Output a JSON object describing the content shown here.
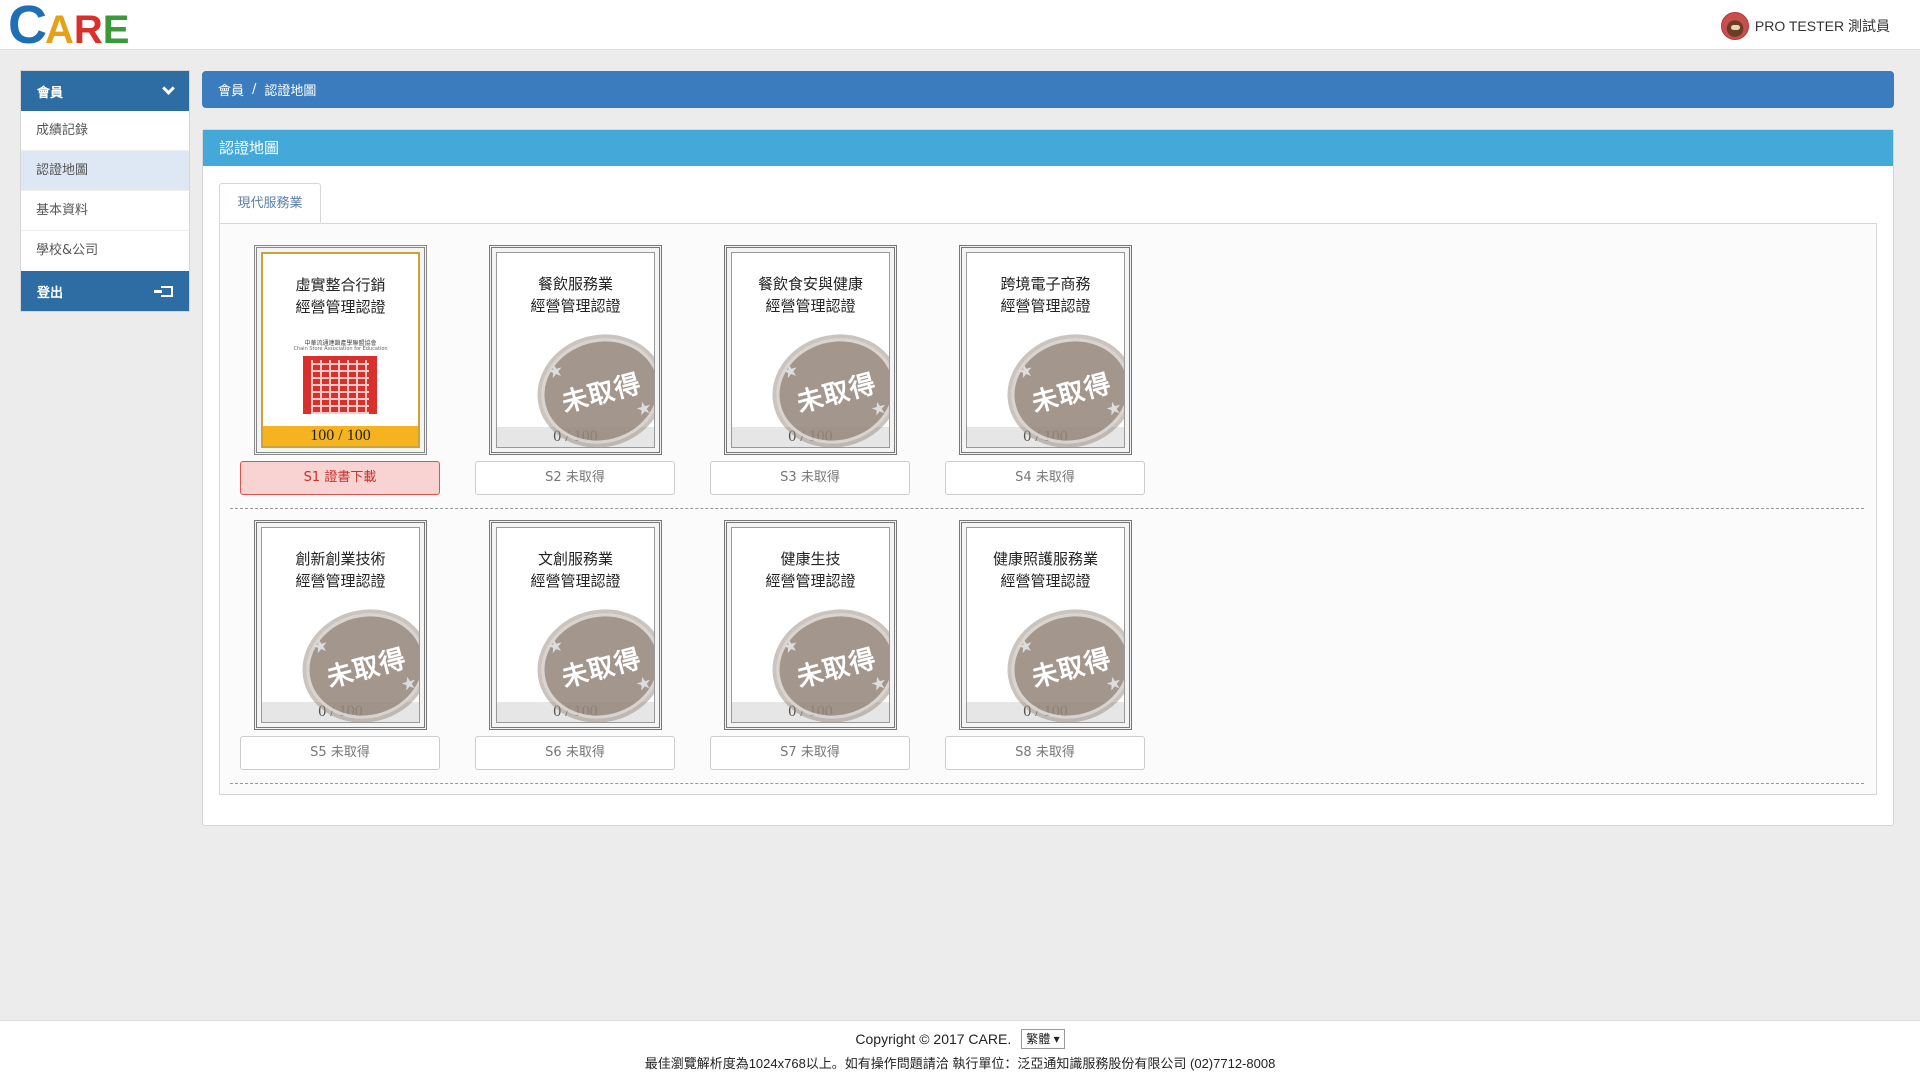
{
  "header": {
    "logo": {
      "c": "C",
      "a": "A",
      "r": "R",
      "e": "E"
    },
    "user_name": "PRO TESTER 測試員"
  },
  "sidebar": {
    "section_label": "會員",
    "items": [
      {
        "label": "成績記錄",
        "active": false
      },
      {
        "label": "認證地圖",
        "active": true
      },
      {
        "label": "基本資料",
        "active": false
      },
      {
        "label": "學校&公司",
        "active": false
      }
    ],
    "logout_label": "登出"
  },
  "breadcrumb": {
    "parent": "會員",
    "separator": "/",
    "current": "認證地圖"
  },
  "panel": {
    "title": "認證地圖",
    "tab_label": "現代服務業"
  },
  "certificates": [
    {
      "line1": "虛實整合行銷",
      "line2": "經營管理認證",
      "score": "100 / 100",
      "button": "S1 證書下載",
      "obtained": true,
      "org": "中華流通連鎖產學聯盟協會",
      "org_en": "Chain Store Association for Education"
    },
    {
      "line1": "餐飲服務業",
      "line2": "經營管理認證",
      "score": "0 / 100",
      "button": "S2 未取得",
      "obtained": false,
      "badge": "未取得"
    },
    {
      "line1": "餐飲食安與健康",
      "line2": "經營管理認證",
      "score": "0 / 100",
      "button": "S3 未取得",
      "obtained": false,
      "badge": "未取得"
    },
    {
      "line1": "跨境電子商務",
      "line2": "經營管理認證",
      "score": "0 / 100",
      "button": "S4 未取得",
      "obtained": false,
      "badge": "未取得"
    },
    {
      "line1": "創新創業技術",
      "line2": "經營管理認證",
      "score": "0 / 100",
      "button": "S5 未取得",
      "obtained": false,
      "badge": "未取得"
    },
    {
      "line1": "文創服務業",
      "line2": "經營管理認證",
      "score": "0 / 100",
      "button": "S6 未取得",
      "obtained": false,
      "badge": "未取得"
    },
    {
      "line1": "健康生技",
      "line2": "經營管理認證",
      "score": "0 / 100",
      "button": "S7 未取得",
      "obtained": false,
      "badge": "未取得"
    },
    {
      "line1": "健康照護服務業",
      "line2": "經營管理認證",
      "score": "0 / 100",
      "button": "S8 未取得",
      "obtained": false,
      "badge": "未取得"
    }
  ],
  "footer": {
    "copyright": "Copyright © 2017 CARE.",
    "language": "繁體 ▾",
    "notice": "最佳瀏覽解析度為1024x768以上。如有操作問題請洽 執行單位：泛亞通知識服務股份有限公司 (02)7712-8008"
  },
  "colors": {
    "primary": "#2e6da4",
    "panel_header": "#44a8d8",
    "obtained_button_bg": "#f9d2d2",
    "obtained_button_text": "#c9302c",
    "score_bar_gold": "#f5b320"
  }
}
